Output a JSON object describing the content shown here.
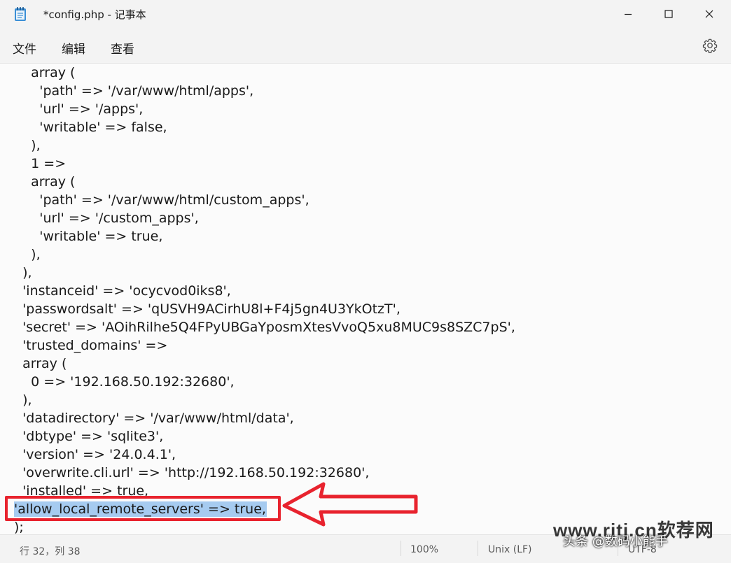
{
  "window": {
    "title": "*config.php - 记事本"
  },
  "menu": {
    "file": "文件",
    "edit": "编辑",
    "view": "查看"
  },
  "icons": {
    "app": "notepad-icon",
    "minimize": "minimize-icon",
    "maximize": "maximize-icon",
    "close": "close-icon",
    "settings": "gear-icon",
    "annotation": "red-arrow-icon"
  },
  "editor": {
    "lines": [
      "    array (",
      "      'path' => '/var/www/html/apps',",
      "      'url' => '/apps',",
      "      'writable' => false,",
      "    ),",
      "    1 =>",
      "    array (",
      "      'path' => '/var/www/html/custom_apps',",
      "      'url' => '/custom_apps',",
      "      'writable' => true,",
      "    ),",
      "  ),",
      "  'instanceid' => 'ocycvod0iks8',",
      "  'passwordsalt' => 'qUSVH9ACirhU8l+F4j5gn4U3YkOtzT',",
      "  'secret' => 'AOihRilhe5Q4FPyUBGaYposmXtesVvoQ5xu8MUC9s8SZC7pS',",
      "  'trusted_domains' =>",
      "  array (",
      "    0 => '192.168.50.192:32680',",
      "  ),",
      "  'datadirectory' => '/var/www/html/data',",
      "  'dbtype' => 'sqlite3',",
      "  'version' => '24.0.4.1',",
      "  'overwrite.cli.url' => 'http://192.168.50.192:32680',",
      "  'installed' => true,",
      "'allow_local_remote_servers' => true,",
      ");"
    ],
    "selected_line_index": 24
  },
  "status": {
    "position": "行 32，列 38",
    "zoom": "100%",
    "line_ending": "Unix (LF)",
    "encoding": "UTF-8"
  },
  "watermark": {
    "site": "www.rjtj.cn软荐网",
    "author": "头条 @数码小能手"
  },
  "colors": {
    "selection": "#a6cbf0",
    "annotation": "#e8232e",
    "chrome": "#f3f3f3",
    "editor_bg": "#fbfbfb"
  }
}
